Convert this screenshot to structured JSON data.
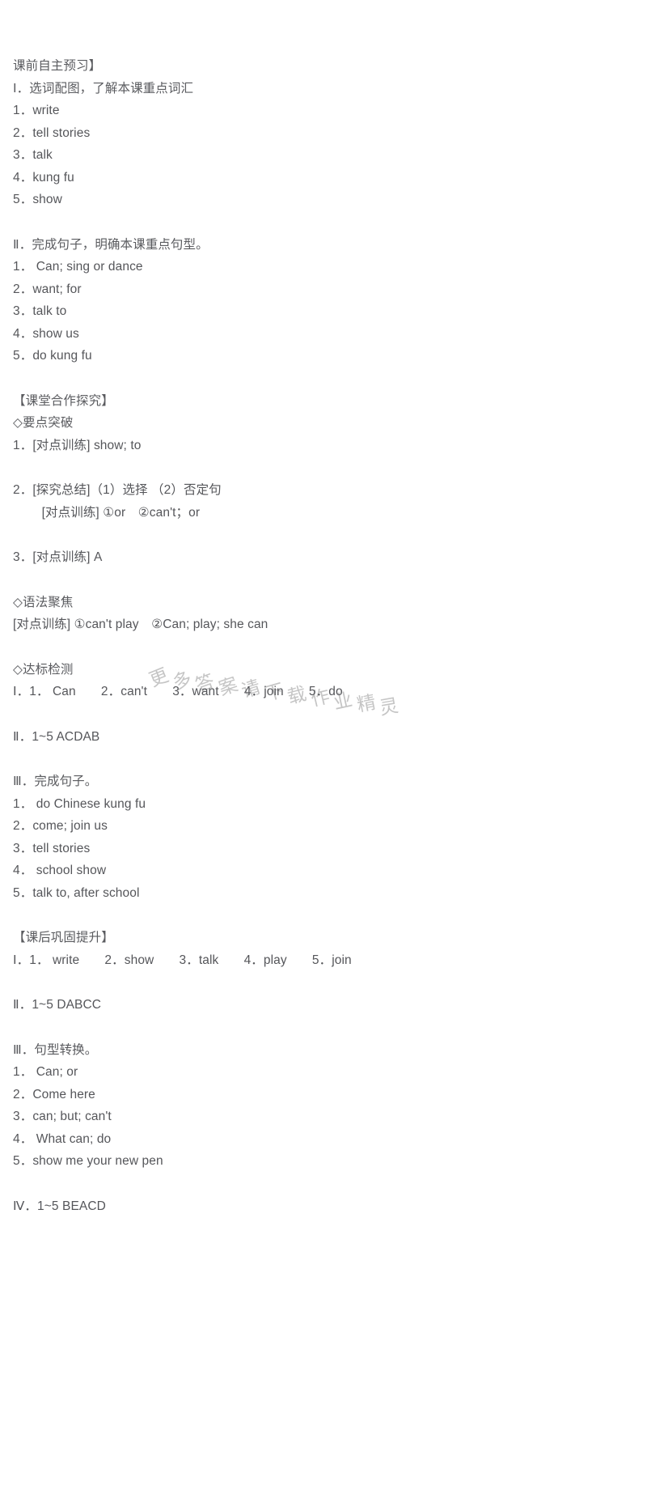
{
  "document": {
    "title": "课前自主预习】",
    "watermark": {
      "text": "更多答案请下载作业精灵",
      "color": "#c2c2c2"
    },
    "sections": [
      {
        "id": "pre-class",
        "heading": "课前自主预习】",
        "blocks": [
          {
            "id": "pre-part-1",
            "label": "Ⅰ．选词配图，了解本课重点词汇",
            "items": [
              "1．write",
              "2．tell stories",
              "3．talk",
              "4．kung fu",
              "5．show"
            ]
          },
          {
            "id": "pre-part-2",
            "label": "Ⅱ．完成句子，明确本课重点句型。",
            "items": [
              "1． Can; sing or dance",
              "2．want; for",
              "3．talk to",
              "4．show us",
              "5．do kung fu"
            ]
          }
        ]
      },
      {
        "id": "in-class",
        "heading": "【课堂合作探究】",
        "subsections": [
          {
            "id": "key-points",
            "label": "◇要点突破",
            "items": [
              "1．[对点训练] show; to",
              "2．[探究总结]（1）选择 （2）否定句",
              "　　 [对点训练] ①or　②can't；or",
              "3．[对点训练] A"
            ]
          },
          {
            "id": "grammar-focus",
            "label": "◇语法聚焦",
            "items": [
              "[对点训练] ①can't play　②Can; play; she can"
            ]
          },
          {
            "id": "standard-test",
            "label": "◇达标检测",
            "items": [
              "Ⅰ．1． Can　　2．can't　　3．want　　4．join　　5．do",
              "Ⅱ．1~5 ACDAB"
            ]
          },
          {
            "id": "complete-sentences",
            "label": "Ⅲ．完成句子。",
            "items": [
              "1． do Chinese kung fu",
              "2．come; join us",
              "3．tell stories",
              "4． school show",
              "5．talk to, after school"
            ]
          }
        ]
      },
      {
        "id": "after-class",
        "heading": "【课后巩固提升】",
        "blocks": [
          {
            "id": "after-part-1",
            "label": "Ⅰ．1． write　　2．show　　3．talk　　4．play　　5．join",
            "items": []
          },
          {
            "id": "after-part-2",
            "label": "Ⅱ．1~5 DABCC",
            "items": []
          },
          {
            "id": "after-part-3",
            "label": "Ⅲ．句型转换。",
            "items": [
              "1． Can; or",
              "2．Come here",
              "3．can; but; can't",
              "4． What can; do",
              "5．show me your new pen"
            ]
          },
          {
            "id": "after-part-4",
            "label": "Ⅳ．1~5 BEACD",
            "items": []
          }
        ]
      }
    ]
  }
}
